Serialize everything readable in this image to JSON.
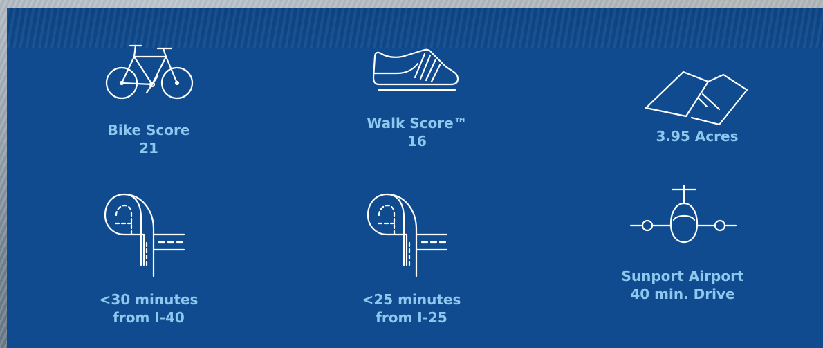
{
  "panel": {
    "background_color": "#0f4b8e",
    "label_color": "#8fc8ee",
    "icon_color": "#ffffff"
  },
  "features": [
    {
      "icon": "bicycle-icon",
      "line1": "Bike Score",
      "line2": "21"
    },
    {
      "icon": "shoe-icon",
      "line1": "Walk Score™",
      "line2": "16"
    },
    {
      "icon": "land-parcel-icon",
      "line1": "3.95 Acres",
      "line2": ""
    },
    {
      "icon": "highway-interchange-icon",
      "line1": "<30 minutes",
      "line2": "from I-40"
    },
    {
      "icon": "highway-interchange-icon",
      "line1": "<25 minutes",
      "line2": "from I-25"
    },
    {
      "icon": "airplane-icon",
      "line1": "Sunport Airport",
      "line2": "40 min. Drive"
    }
  ]
}
